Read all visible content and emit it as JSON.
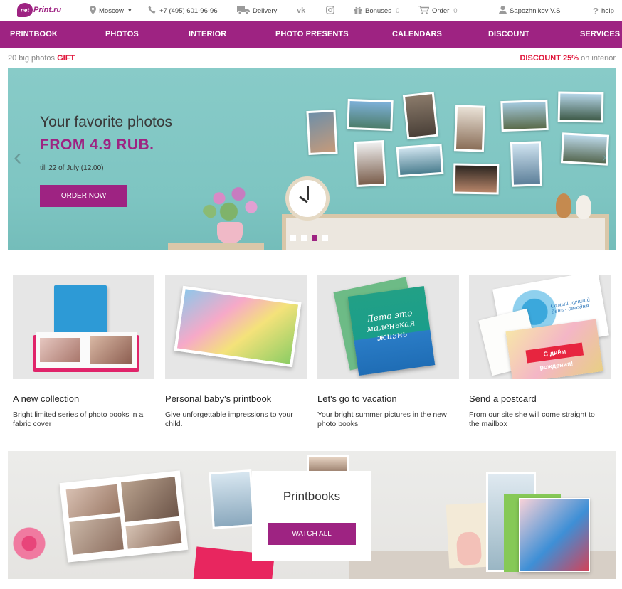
{
  "topbar": {
    "logo_mark": "net",
    "logo_text": "Print.ru",
    "city": "Moscow",
    "phone": "+7 (495) 601-96-96",
    "delivery": "Delivery",
    "bonuses_label": "Bonuses",
    "bonuses_count": "0",
    "order_label": "Order",
    "order_count": "0",
    "user": "Sapozhnikov V.S",
    "help": "help"
  },
  "nav": {
    "items": [
      "PRINTBOOK",
      "PHOTOS",
      "INTERIOR",
      "PHOTO PRESENTS",
      "CALENDARS",
      "DISCOUNT",
      "SERVICES"
    ]
  },
  "promo": {
    "left_text": "20 big photos",
    "left_highlight": "GIFT",
    "right_highlight": "DISCOUNT 25%",
    "right_text": "on interior"
  },
  "hero": {
    "title": "Your favorite photos",
    "price": "FROM 4.9 RUB.",
    "date": "till 22 of July (12.00)",
    "button": "ORDER NOW",
    "arrow_left": "‹",
    "arrow_right": "›",
    "active_slide": 3,
    "slide_count": 4
  },
  "cards": [
    {
      "title": "A new collection",
      "desc": "Bright limited series of photo books in a fabric cover"
    },
    {
      "title": "Personal baby's printbook",
      "desc": "Give unforgettable impressions to your child."
    },
    {
      "title": "Let's go to vacation",
      "desc": "Your bright summer pictures in the new photo books"
    },
    {
      "title": "Send a postcard",
      "desc": "From our site she will come straight to the mailbox"
    }
  ],
  "card_art": {
    "vacation_book_text": "Лето это маленькая жизнь",
    "postcard_text": "С днём рождения!",
    "postcard_script": "Самый лучший день - сегодня"
  },
  "banner": {
    "title": "Printbooks",
    "button": "WATCH ALL"
  },
  "colors": {
    "brand": "#9e2382",
    "accent_red": "#e0153a",
    "hero_bg": "#88cbc8"
  },
  "icons": [
    "location-icon",
    "phone-icon",
    "truck-icon",
    "vk-icon",
    "instagram-icon",
    "gift-icon",
    "cart-icon",
    "user-icon",
    "help-icon"
  ]
}
